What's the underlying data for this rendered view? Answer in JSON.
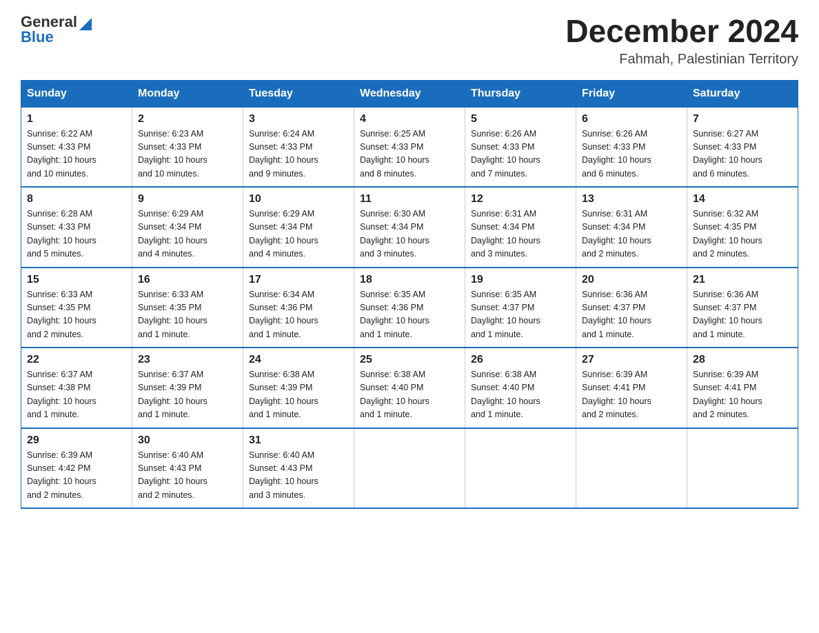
{
  "header": {
    "logo_general": "General",
    "logo_blue": "Blue",
    "month_title": "December 2024",
    "location": "Fahmah, Palestinian Territory"
  },
  "columns": [
    "Sunday",
    "Monday",
    "Tuesday",
    "Wednesday",
    "Thursday",
    "Friday",
    "Saturday"
  ],
  "weeks": [
    [
      {
        "day": "1",
        "info": "Sunrise: 6:22 AM\nSunset: 4:33 PM\nDaylight: 10 hours\nand 10 minutes."
      },
      {
        "day": "2",
        "info": "Sunrise: 6:23 AM\nSunset: 4:33 PM\nDaylight: 10 hours\nand 10 minutes."
      },
      {
        "day": "3",
        "info": "Sunrise: 6:24 AM\nSunset: 4:33 PM\nDaylight: 10 hours\nand 9 minutes."
      },
      {
        "day": "4",
        "info": "Sunrise: 6:25 AM\nSunset: 4:33 PM\nDaylight: 10 hours\nand 8 minutes."
      },
      {
        "day": "5",
        "info": "Sunrise: 6:26 AM\nSunset: 4:33 PM\nDaylight: 10 hours\nand 7 minutes."
      },
      {
        "day": "6",
        "info": "Sunrise: 6:26 AM\nSunset: 4:33 PM\nDaylight: 10 hours\nand 6 minutes."
      },
      {
        "day": "7",
        "info": "Sunrise: 6:27 AM\nSunset: 4:33 PM\nDaylight: 10 hours\nand 6 minutes."
      }
    ],
    [
      {
        "day": "8",
        "info": "Sunrise: 6:28 AM\nSunset: 4:33 PM\nDaylight: 10 hours\nand 5 minutes."
      },
      {
        "day": "9",
        "info": "Sunrise: 6:29 AM\nSunset: 4:34 PM\nDaylight: 10 hours\nand 4 minutes."
      },
      {
        "day": "10",
        "info": "Sunrise: 6:29 AM\nSunset: 4:34 PM\nDaylight: 10 hours\nand 4 minutes."
      },
      {
        "day": "11",
        "info": "Sunrise: 6:30 AM\nSunset: 4:34 PM\nDaylight: 10 hours\nand 3 minutes."
      },
      {
        "day": "12",
        "info": "Sunrise: 6:31 AM\nSunset: 4:34 PM\nDaylight: 10 hours\nand 3 minutes."
      },
      {
        "day": "13",
        "info": "Sunrise: 6:31 AM\nSunset: 4:34 PM\nDaylight: 10 hours\nand 2 minutes."
      },
      {
        "day": "14",
        "info": "Sunrise: 6:32 AM\nSunset: 4:35 PM\nDaylight: 10 hours\nand 2 minutes."
      }
    ],
    [
      {
        "day": "15",
        "info": "Sunrise: 6:33 AM\nSunset: 4:35 PM\nDaylight: 10 hours\nand 2 minutes."
      },
      {
        "day": "16",
        "info": "Sunrise: 6:33 AM\nSunset: 4:35 PM\nDaylight: 10 hours\nand 1 minute."
      },
      {
        "day": "17",
        "info": "Sunrise: 6:34 AM\nSunset: 4:36 PM\nDaylight: 10 hours\nand 1 minute."
      },
      {
        "day": "18",
        "info": "Sunrise: 6:35 AM\nSunset: 4:36 PM\nDaylight: 10 hours\nand 1 minute."
      },
      {
        "day": "19",
        "info": "Sunrise: 6:35 AM\nSunset: 4:37 PM\nDaylight: 10 hours\nand 1 minute."
      },
      {
        "day": "20",
        "info": "Sunrise: 6:36 AM\nSunset: 4:37 PM\nDaylight: 10 hours\nand 1 minute."
      },
      {
        "day": "21",
        "info": "Sunrise: 6:36 AM\nSunset: 4:37 PM\nDaylight: 10 hours\nand 1 minute."
      }
    ],
    [
      {
        "day": "22",
        "info": "Sunrise: 6:37 AM\nSunset: 4:38 PM\nDaylight: 10 hours\nand 1 minute."
      },
      {
        "day": "23",
        "info": "Sunrise: 6:37 AM\nSunset: 4:39 PM\nDaylight: 10 hours\nand 1 minute."
      },
      {
        "day": "24",
        "info": "Sunrise: 6:38 AM\nSunset: 4:39 PM\nDaylight: 10 hours\nand 1 minute."
      },
      {
        "day": "25",
        "info": "Sunrise: 6:38 AM\nSunset: 4:40 PM\nDaylight: 10 hours\nand 1 minute."
      },
      {
        "day": "26",
        "info": "Sunrise: 6:38 AM\nSunset: 4:40 PM\nDaylight: 10 hours\nand 1 minute."
      },
      {
        "day": "27",
        "info": "Sunrise: 6:39 AM\nSunset: 4:41 PM\nDaylight: 10 hours\nand 2 minutes."
      },
      {
        "day": "28",
        "info": "Sunrise: 6:39 AM\nSunset: 4:41 PM\nDaylight: 10 hours\nand 2 minutes."
      }
    ],
    [
      {
        "day": "29",
        "info": "Sunrise: 6:39 AM\nSunset: 4:42 PM\nDaylight: 10 hours\nand 2 minutes."
      },
      {
        "day": "30",
        "info": "Sunrise: 6:40 AM\nSunset: 4:43 PM\nDaylight: 10 hours\nand 2 minutes."
      },
      {
        "day": "31",
        "info": "Sunrise: 6:40 AM\nSunset: 4:43 PM\nDaylight: 10 hours\nand 3 minutes."
      },
      {
        "day": "",
        "info": ""
      },
      {
        "day": "",
        "info": ""
      },
      {
        "day": "",
        "info": ""
      },
      {
        "day": "",
        "info": ""
      }
    ]
  ]
}
